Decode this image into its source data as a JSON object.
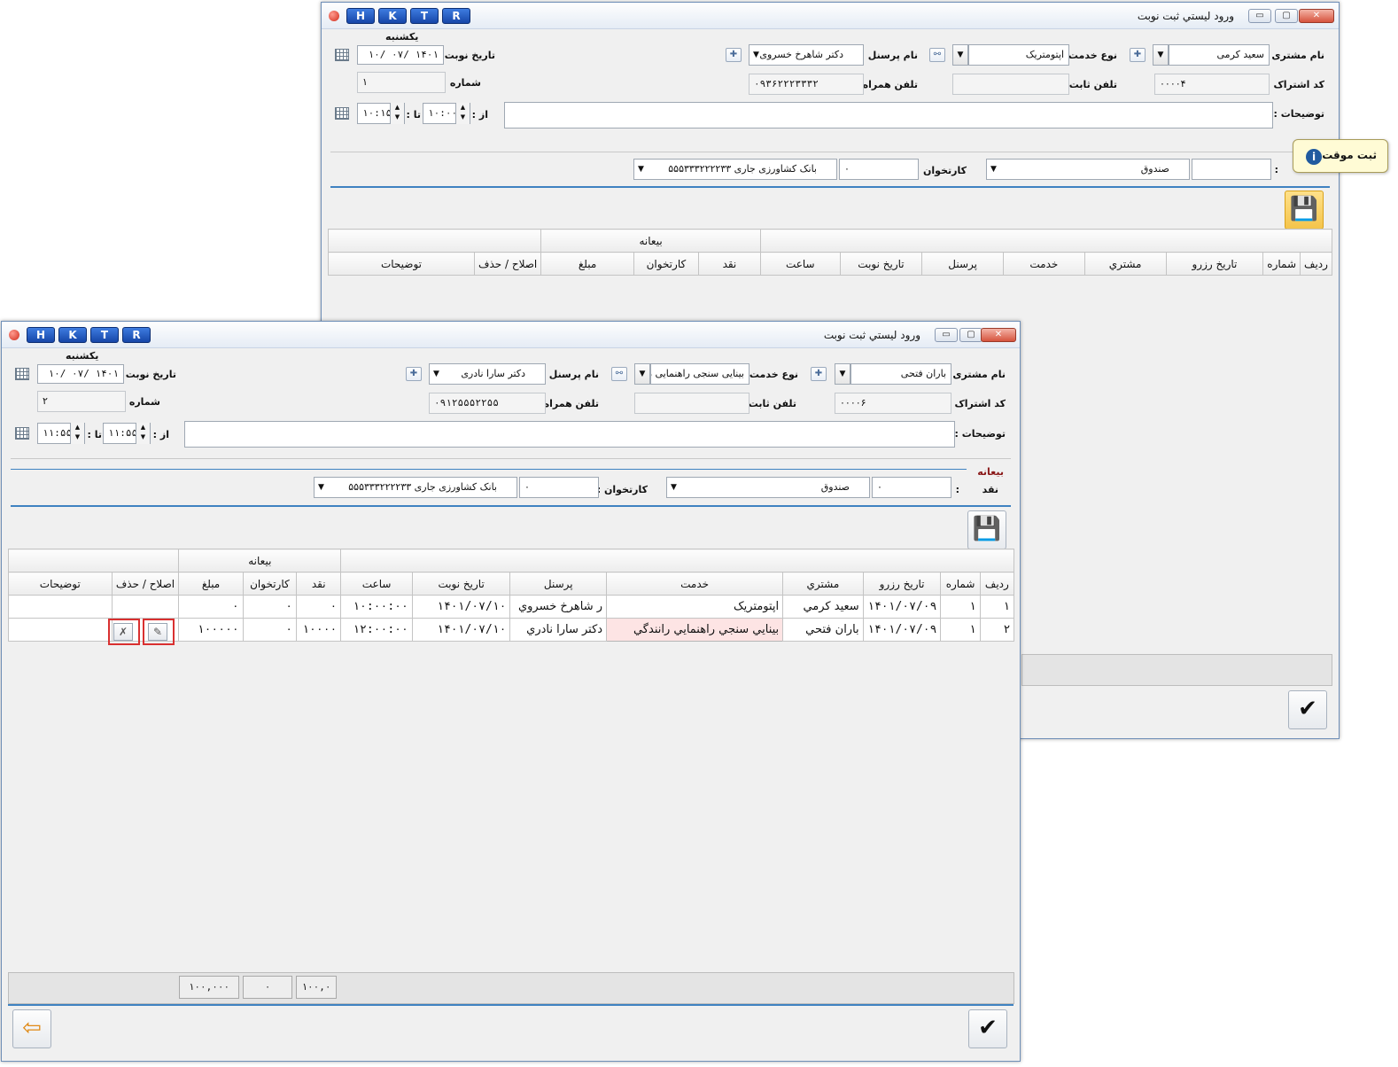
{
  "hotkeys": [
    "H",
    "K",
    "T",
    "R"
  ],
  "tooltip": {
    "text": "ثبت موقت",
    "icon": "info-icon"
  },
  "labels": {
    "customer_name": "نام مشتری :",
    "service_type": "نوع خدمت :",
    "personnel_name": "نام پرسنل :",
    "appointment_date": "تاریخ نوبت :",
    "subscription_code": "کد اشتراک :",
    "landline": "تلفن ثابت :",
    "mobile": "تلفن همراه :",
    "number": "شماره :",
    "description": "توضیحات :",
    "from": "از :",
    "to": "تا :",
    "card_reader": "کارتخوان :",
    "cash": "نقد",
    "deposit": "بیعانه",
    "colon": ":"
  },
  "grid_headers": {
    "row": "ردیف",
    "number": "شماره",
    "reserve_date": "تاريخ رزرو",
    "customer": "مشتري",
    "service": "خدمت",
    "personnel": "پرسنل",
    "appt_date": "تاريخ نوبت",
    "time": "ساعت",
    "cash": "نقد",
    "card": "كارتخوان",
    "amount": "مبلغ",
    "edit_delete": "اصلاح / حذف",
    "description": "توضیحات",
    "deposit_group": "بیعانه"
  },
  "window1": {
    "title": "ورود ليستي ثبت نوبت",
    "customer_name": "سعید کرمی",
    "service_type": "اپتومتریک",
    "personnel_name": "دکتر شاهرخ خسروی",
    "weekday": "یکشنبه",
    "date_value": "۱۴۰۱ /۰۷ /۱۰",
    "subscription_code": "۰۰۰۰۴",
    "landline": "",
    "mobile": "۰۹۳۶۲۲۲۳۳۳۲",
    "number": "۱",
    "time_from": "۱۰:۰۰",
    "time_to": "۱۰:۱۵",
    "description": "",
    "cash_value": "",
    "cash_box": "صندوق",
    "card_value": "۰",
    "bank": "بانک کشاورزی جاری ۵۵۵۳۳۳۲۲۲۲۳۳"
  },
  "window2": {
    "title": "ورود ليستي ثبت نوبت",
    "customer_name": "باران فتحی",
    "service_type": "بینایی سنجی راهنمایی ر",
    "personnel_name": "دکتر سارا نادری",
    "weekday": "یکشنبه",
    "date_value": "۱۴۰۱ /۰۷ /۱۰",
    "subscription_code": "۰۰۰۰۶",
    "landline": "",
    "mobile": "۰۹۱۲۵۵۵۲۲۵۵",
    "number": "۲",
    "time_from": "۱۱:۵۵",
    "time_to": "۱۱:۵۵",
    "description": "",
    "cash_value": "۰",
    "cash_box": "صندوق",
    "card_value": "۰",
    "bank": "بانک کشاورزی جاری ۵۵۵۳۳۳۲۲۲۲۳۳",
    "rows": [
      {
        "row": "۱",
        "number": "۱",
        "reserve_date": "۱۴۰۱/۰۷/۰۹",
        "customer": "سعيد كرمي",
        "service": "اپتومتريک",
        "personnel": "ر شاهرخ خسروي",
        "appt_date": "۱۴۰۱/۰۷/۱۰",
        "time": "۱۰:۰۰:۰۰",
        "cash": "۰",
        "card": "۰",
        "amount": "۰",
        "description": ""
      },
      {
        "row": "۲",
        "number": "۱",
        "reserve_date": "۱۴۰۱/۰۷/۰۹",
        "customer": "باران فتحي",
        "service": "بينايي سنجي راهنمايي رانندگي",
        "personnel": "دكتر سارا نادري",
        "appt_date": "۱۴۰۱/۰۷/۱۰",
        "time": "۱۲:۰۰:۰۰",
        "cash": "۱۰۰۰۰",
        "card": "۰",
        "amount": "۱۰۰۰۰۰",
        "description": ""
      }
    ],
    "totals": {
      "amount": "۱۰۰,۰۰۰",
      "card": "۰",
      "cash": "۱۰۰,۰"
    }
  }
}
